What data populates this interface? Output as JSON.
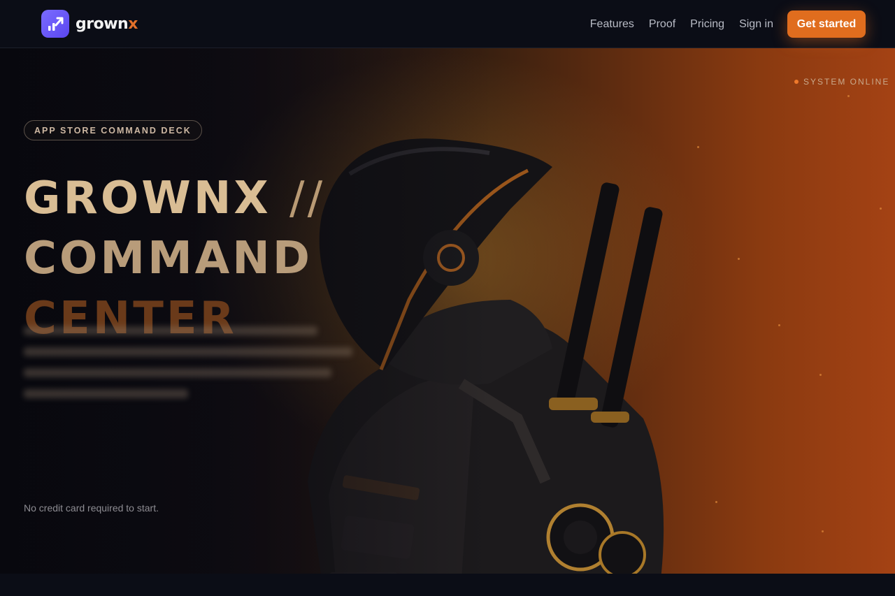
{
  "brand": {
    "name_main": "grown",
    "name_accent": "x",
    "accent_color": "#e2702a",
    "logo_bg": "#6a5af5"
  },
  "nav": {
    "links": [
      "Features",
      "Proof",
      "Pricing",
      "Sign in"
    ],
    "cta_label": "Get started",
    "cta_color": "#e06d1e"
  },
  "hero": {
    "status_text": "SYSTEM ONLINE",
    "eyebrow": "APP STORE COMMAND DECK",
    "headline_line1": "GROWNX",
    "headline_sep": "//",
    "headline_line2": "COMMAND",
    "headline_line3": "CENTER",
    "note": "No credit card required to start."
  }
}
